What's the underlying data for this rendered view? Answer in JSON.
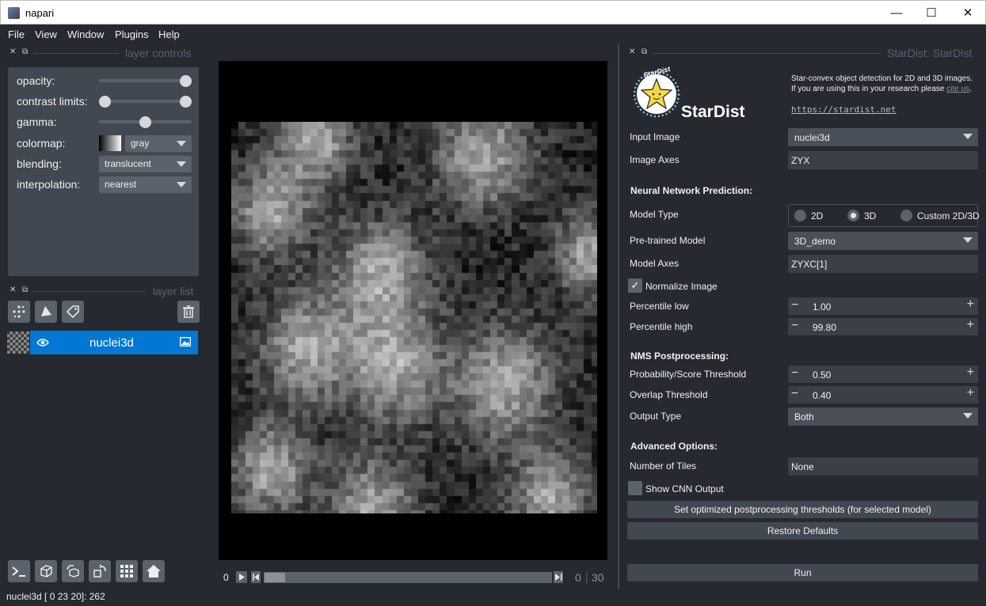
{
  "window": {
    "title": "napari",
    "minimize": "—",
    "maximize": "☐",
    "close": "✕"
  },
  "menu": [
    "File",
    "View",
    "Window",
    "Plugins",
    "Help"
  ],
  "layer_controls": {
    "header": "layer controls",
    "opacity_label": "opacity:",
    "contrast_label": "contrast limits:",
    "gamma_label": "gamma:",
    "colormap_label": "colormap:",
    "colormap_value": "gray",
    "blending_label": "blending:",
    "blending_value": "translucent",
    "interpolation_label": "interpolation:",
    "interpolation_value": "nearest",
    "opacity": 1.0,
    "contrast_limits": [
      0,
      1
    ],
    "gamma": 0.5
  },
  "layer_list": {
    "header": "layer list",
    "layers": [
      {
        "name": "nuclei3d",
        "visible": true
      }
    ]
  },
  "dims": {
    "current": "0",
    "index": "0",
    "total": "30",
    "separator": "|"
  },
  "status": "nuclei3d [ 0 23 20]: 262",
  "stardist": {
    "header": "StarDist: StarDist",
    "logo_text": "StarDist",
    "logo_arc": "StarDist",
    "description_1": "Star-convex object detection for 2D and 3D images.",
    "description_2a": "If you are using this in your research please ",
    "description_link": "cite us",
    "description_2b": ".",
    "url": "https://stardist.net",
    "input_image_label": "Input Image",
    "input_image_value": "nuclei3d",
    "image_axes_label": "Image Axes",
    "image_axes_value": "ZYX",
    "nn_section": "Neural Network Prediction:",
    "model_type_label": "Model Type",
    "model_type_options": [
      "2D",
      "3D",
      "Custom 2D/3D"
    ],
    "model_type_selected": "3D",
    "pretrained_label": "Pre-trained Model",
    "pretrained_value": "3D_demo",
    "model_axes_label": "Model Axes",
    "model_axes_value": "ZYXC[1]",
    "normalize_label": "Normalize Image",
    "normalize_checked": true,
    "perc_low_label": "Percentile low",
    "perc_low_value": "1.00",
    "perc_high_label": "Percentile high",
    "perc_high_value": "99.80",
    "nms_section": "NMS Postprocessing:",
    "prob_label": "Probability/Score Threshold",
    "prob_value": "0.50",
    "overlap_label": "Overlap Threshold",
    "overlap_value": "0.40",
    "output_label": "Output Type",
    "output_value": "Both",
    "adv_section": "Advanced Options:",
    "tiles_label": "Number of Tiles",
    "tiles_value": "None",
    "cnn_label": "Show CNN Output",
    "cnn_checked": false,
    "opt_button": "Set optimized postprocessing thresholds (for selected model)",
    "restore_button": "Restore Defaults",
    "run_button": "Run"
  },
  "colors": {
    "bg": "#262930",
    "panel": "#414851",
    "accent": "#0078d4"
  },
  "icons": {
    "dock_close": "close-icon",
    "dock_float": "float-icon",
    "points": "new-points-icon",
    "shapes": "new-shapes-icon",
    "labels": "new-labels-icon",
    "delete": "trash-icon",
    "eye": "eye-icon",
    "image": "image-layer-icon",
    "console": "console-icon",
    "ndisplay": "3d-toggle-icon",
    "roll": "roll-axes-icon",
    "transpose": "transpose-icon",
    "grid": "grid-icon",
    "home": "home-icon",
    "play": "play-icon",
    "step_back": "step-back-icon",
    "step_forward": "step-forward-icon"
  }
}
